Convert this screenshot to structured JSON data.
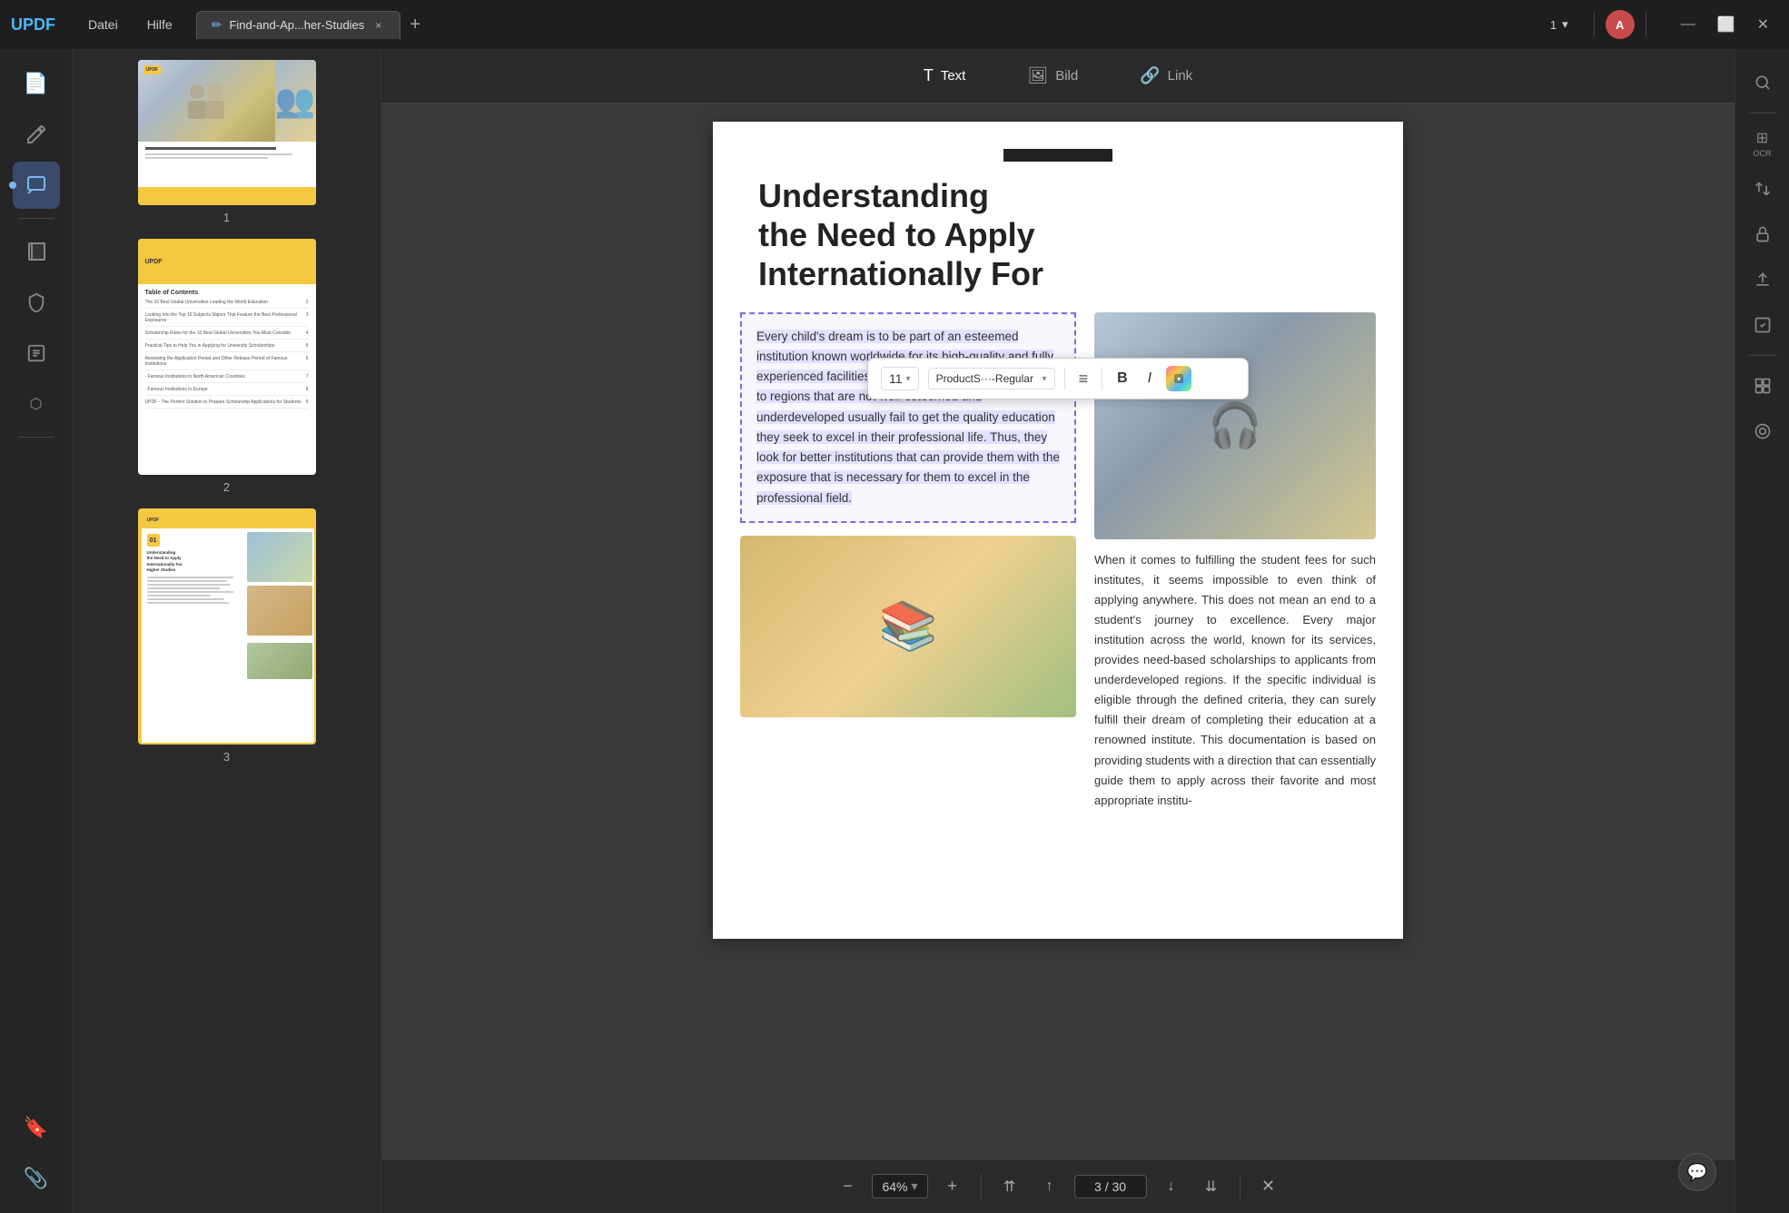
{
  "app": {
    "logo": "UPDF",
    "menus": [
      "Datei",
      "Hilfe"
    ],
    "tab": {
      "icon": "✏️",
      "label": "Find-and-Ap...her-Studies",
      "close": "×"
    },
    "add_tab": "+",
    "page_nav": {
      "current": "1",
      "chevron": "▾"
    },
    "avatar_initials": "A",
    "window_controls": {
      "minimize": "—",
      "maximize": "⬜",
      "close": "✕"
    }
  },
  "toolbar": {
    "text_label": "Text",
    "bild_label": "Bild",
    "link_label": "Link"
  },
  "text_edit_toolbar": {
    "font_size": "11",
    "font_size_chevron": "▾",
    "font_name": "ProductS···-Regular",
    "font_name_chevron": "▾",
    "align_icon": "≡",
    "bold": "B",
    "italic": "I"
  },
  "sidebar": {
    "icons": [
      {
        "name": "pages-icon",
        "symbol": "📄",
        "active": false
      },
      {
        "name": "edit-icon",
        "symbol": "✏️",
        "active": false
      },
      {
        "name": "comment-icon",
        "symbol": "💬",
        "active": true
      },
      {
        "name": "pages2-icon",
        "symbol": "📋",
        "active": false
      },
      {
        "name": "protect-icon",
        "symbol": "🔒",
        "active": false
      },
      {
        "name": "form-icon",
        "symbol": "📝",
        "active": false
      },
      {
        "name": "layers-icon",
        "symbol": "◼",
        "active": false
      },
      {
        "name": "bookmark-icon",
        "symbol": "🔖",
        "active": false
      },
      {
        "name": "paperclip-icon",
        "symbol": "📎",
        "active": false
      }
    ]
  },
  "right_sidebar": {
    "buttons": [
      {
        "name": "search-btn",
        "symbol": "🔍"
      },
      {
        "name": "ocr-btn",
        "label": "OCR"
      },
      {
        "name": "convert-btn",
        "symbol": "⇄"
      },
      {
        "name": "protect-btn",
        "symbol": "🔒"
      },
      {
        "name": "share-btn",
        "symbol": "↑"
      },
      {
        "name": "sign-btn",
        "symbol": "✔"
      },
      {
        "name": "organize-btn",
        "symbol": "⊟"
      },
      {
        "name": "snapshot-btn",
        "symbol": "⊡"
      }
    ]
  },
  "thumbnails": [
    {
      "number": "1"
    },
    {
      "number": "2",
      "toc_title": "Table of Contents"
    },
    {
      "number": "3",
      "selected": true,
      "chapter_num": "01",
      "chapter_title": "Understanding the Need to Apply Internationally For Higher Studies"
    }
  ],
  "pdf_page": {
    "main_title": "Understanding\nthe Need to Apply\nInternationally For",
    "selected_text": "Every child's dream is to be part of an esteemed institution known worldwide for its high-quality and fully experienced facilities and services. Students belonging to regions that are not well-esteemed and underdeveloped usually fail to get the quality education they seek to excel in their professional life. Thus, they look for better institutions that can provide them with the exposure that is necessary for them to excel in the professional field.",
    "right_body": "When it comes to fulfilling the student fees for such institutes, it seems impossible to even think of applying anywhere. This does not mean an end to a student's journey to excellence. Every major institution across the world, known for its services, provides need-based scholarships to applicants from underdeveloped regions. If the specific individual is eligible through the defined criteria, they can surely fulfill their dream of completing their education at a renowned institute. This documentation is based on providing students with a direction that can essentially guide them to apply across their favorite and most appropriate institu-"
  },
  "bottom_bar": {
    "zoom_out": "−",
    "zoom_level": "64%",
    "zoom_chevron": "▾",
    "zoom_in": "+",
    "nav_first": "⇈",
    "nav_prev": "↑",
    "nav_next": "↓",
    "nav_last": "⇊",
    "page_current": "3",
    "page_separator": "/",
    "page_total": "30",
    "close": "✕"
  }
}
